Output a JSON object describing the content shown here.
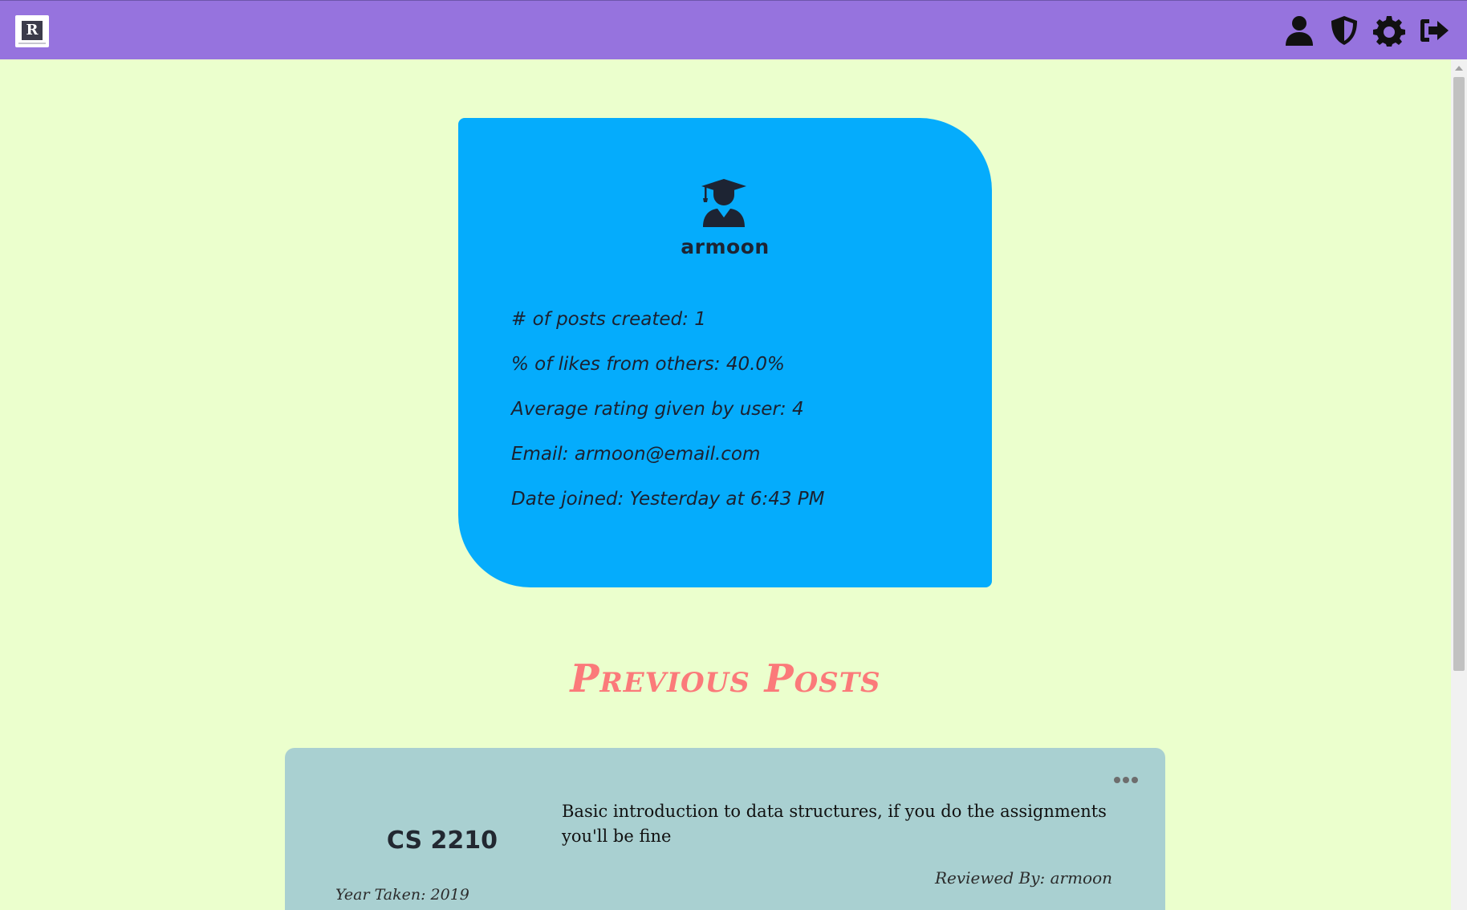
{
  "header": {
    "logo_letter": "R",
    "icons": [
      "user-icon",
      "shield-icon",
      "gear-icon",
      "logout-icon"
    ]
  },
  "profile": {
    "avatar_icon": "graduate-icon",
    "username": "armoon",
    "stats": [
      "# of posts created: 1",
      "% of likes from others: 40.0%",
      "Average rating given by user: 4",
      "Email: armoon@email.com",
      "Date joined: Yesterday at 6:43 PM"
    ]
  },
  "previous_posts": {
    "title": "Previous Posts",
    "posts": [
      {
        "course": "CS 2210",
        "review": "Basic introduction to data structures, if you do the assignments you'll be fine",
        "reviewed_by": "Reviewed By: armoon",
        "year_taken": "Year Taken: 2019"
      }
    ]
  },
  "colors": {
    "topbar": "#9673de",
    "background": "#ebffcd",
    "profile_card": "#05acfc",
    "section_title": "#fb7a7a",
    "post_card": "#a9d0d1"
  }
}
